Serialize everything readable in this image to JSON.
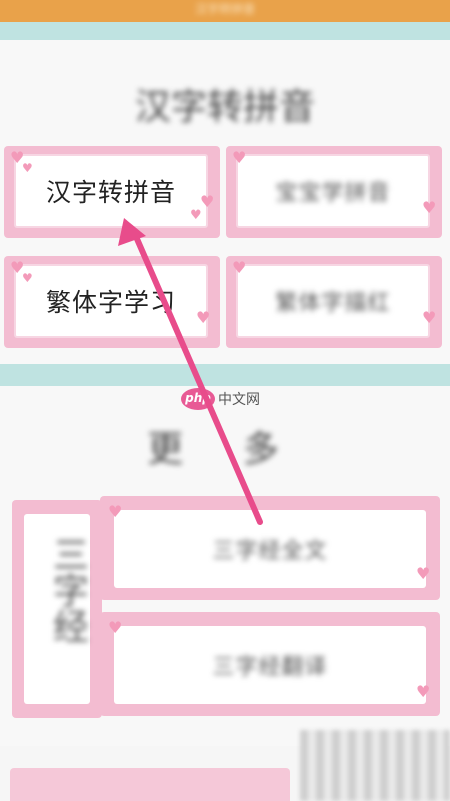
{
  "header": {
    "title": "汉字转拼音"
  },
  "sections": {
    "main_title": "汉字转拼音",
    "more_title": "更 多"
  },
  "tiles": [
    {
      "label": "汉字转拼音"
    },
    {
      "label": "宝宝学拼音"
    },
    {
      "label": "繁体字学习"
    },
    {
      "label": "繁体字描红"
    }
  ],
  "more": {
    "sidebar_label": "三字经",
    "items": [
      {
        "label": "三字经全文"
      },
      {
        "label": "三字经翻译"
      }
    ]
  },
  "watermark": {
    "logo": "php",
    "text": "中文网"
  },
  "colors": {
    "accent": "#e84c8b",
    "tile_pink": "#f3bcd1",
    "header": "#e9a24a",
    "teal": "#bfe3e1"
  }
}
